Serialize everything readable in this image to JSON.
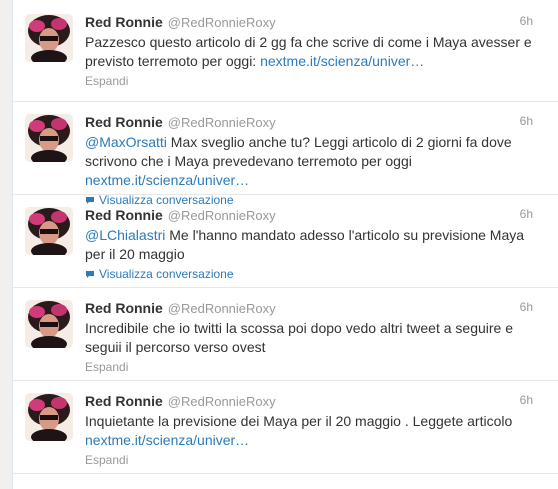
{
  "tweets": [
    {
      "fullname": "Red Ronnie",
      "username": "@RedRonnieRoxy",
      "time": "6h",
      "mention": "",
      "text": "Pazzesco questo articolo di 2 gg fa che scrive di come i Maya avesser e previsto terremoto per oggi: ",
      "link": "nextme.it/scienza/univer…",
      "action": "Espandi",
      "action_type": "expand"
    },
    {
      "fullname": "Red Ronnie",
      "username": "@RedRonnieRoxy",
      "time": "6h",
      "mention": "@MaxOrsatti",
      "text": " Max sveglio anche tu? Leggi articolo di 2 giorni fa dove scrivono che i Maya prevedevano terremoto per oggi ",
      "link": "nextme.it/scienza/univer…",
      "action": "Visualizza conversazione",
      "action_type": "conversation"
    },
    {
      "fullname": "Red Ronnie",
      "username": "@RedRonnieRoxy",
      "time": "6h",
      "mention": "@LChialastri",
      "text": " Me l'hanno mandato adesso l'articolo su previsione Maya per il 20 maggio",
      "link": "",
      "action": "Visualizza conversazione",
      "action_type": "conversation"
    },
    {
      "fullname": "Red Ronnie",
      "username": "@RedRonnieRoxy",
      "time": "6h",
      "mention": "",
      "text": "Incredibile che io twitti la scossa poi dopo vedo altri tweet a seguire e seguii il percorso verso ovest",
      "link": "",
      "action": "Espandi",
      "action_type": "expand"
    },
    {
      "fullname": "Red Ronnie",
      "username": "@RedRonnieRoxy",
      "time": "6h",
      "mention": "",
      "text": "Inquietante la previsione dei Maya per il 20 maggio . Leggete articolo ",
      "link": "nextme.it/scienza/univer…",
      "action": "Espandi",
      "action_type": "expand"
    }
  ],
  "colors": {
    "link": "#2b7bb9",
    "meta": "#999999",
    "text": "#333333"
  },
  "icons": {
    "conversation": "speech-bubble-icon"
  }
}
